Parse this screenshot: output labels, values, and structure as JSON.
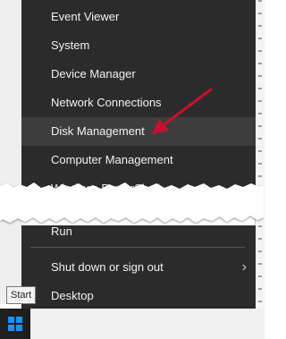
{
  "menu": {
    "items": [
      {
        "label": "Event Viewer"
      },
      {
        "label": "System"
      },
      {
        "label": "Device Manager"
      },
      {
        "label": "Network Connections"
      },
      {
        "label": "Disk Management"
      },
      {
        "label": "Computer Management"
      },
      {
        "label": "Windows PowerShell"
      },
      {
        "label": "Run"
      },
      {
        "label": "Shut down or sign out"
      },
      {
        "label": "Desktop"
      }
    ],
    "selected": "Disk Management"
  },
  "tooltip": {
    "text": "Start"
  },
  "colors": {
    "menu_bg": "#2b2b2b",
    "menu_text": "#f2f2f2",
    "annotation_arrow": "#c8102e",
    "start_logo": "#1e90ff"
  },
  "icons": [
    "chevron-right-icon",
    "windows-logo-icon",
    "annotation-arrow-icon"
  ]
}
